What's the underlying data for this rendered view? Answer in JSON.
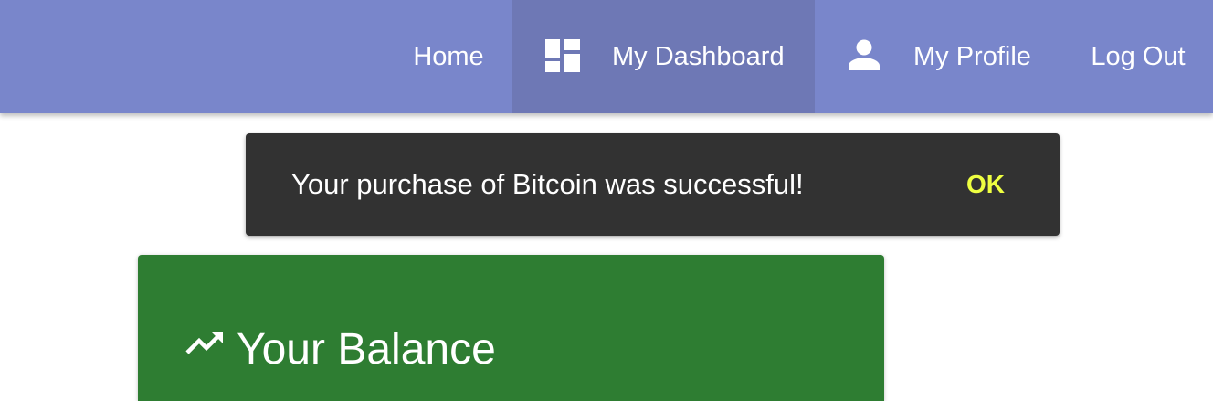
{
  "nav": {
    "home_label": "Home",
    "dashboard_label": "My Dashboard",
    "dashboard_icon": "dashboard-icon",
    "profile_label": "My Profile",
    "profile_icon": "person-icon",
    "logout_label": "Log Out",
    "active_item": "My Dashboard"
  },
  "snackbar": {
    "message": "Your purchase of Bitcoin was successful!",
    "action_label": "OK"
  },
  "balance_card": {
    "title": "Your Balance",
    "icon": "trending-up-icon"
  },
  "colors": {
    "topbar": "#7986cb",
    "topbar_active": "#6e78b5",
    "snackbar_bg": "#323232",
    "snackbar_action": "#eeff41",
    "balance_card": "#2e7d32"
  }
}
